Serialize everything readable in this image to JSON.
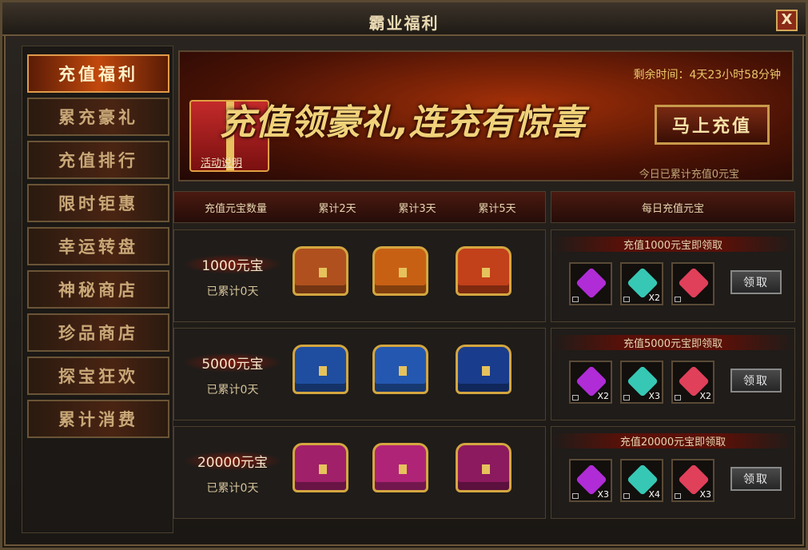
{
  "window": {
    "title": "霸业福利",
    "close_label": "X"
  },
  "sidebar": {
    "items": [
      {
        "label": "充值福利",
        "active": true
      },
      {
        "label": "累充豪礼"
      },
      {
        "label": "充值排行"
      },
      {
        "label": "限时钜惠"
      },
      {
        "label": "幸运转盘"
      },
      {
        "label": "神秘商店"
      },
      {
        "label": "珍品商店"
      },
      {
        "label": "探宝狂欢"
      },
      {
        "label": "累计消费"
      }
    ]
  },
  "banner": {
    "slogan": "充值领豪礼,连充有惊喜",
    "remaining": "剩余时间：4天23小时58分钟",
    "charge_button": "马上充值",
    "explain_link": "活动说明",
    "monthly_total": "今日已累计充值0元宝"
  },
  "table_head": {
    "col1": "充值元宝数量",
    "col2": "累计2天",
    "col3": "累计3天",
    "col4": "累计5天",
    "daily": "每日充值元宝"
  },
  "tiers": [
    {
      "amount": "1000元宝",
      "days": "已累计0天",
      "color": "#b0501e",
      "daily_label": "充值1000元宝即领取",
      "qty": [
        "",
        "X2",
        ""
      ],
      "claim": "领取"
    },
    {
      "amount": "5000元宝",
      "days": "已累计0天",
      "color": "#1f4ea0",
      "daily_label": "充值5000元宝即领取",
      "qty": [
        "X2",
        "X3",
        "X2"
      ],
      "claim": "领取"
    },
    {
      "amount": "20000元宝",
      "days": "已累计0天",
      "color": "#a0206a",
      "daily_label": "充值20000元宝即领取",
      "qty": [
        "X3",
        "X4",
        "X3"
      ],
      "claim": "领取"
    }
  ],
  "colors": {
    "gem_purple": "#b02cd6",
    "gem_teal": "#36c8b4",
    "gem_red": "#e0405a"
  }
}
